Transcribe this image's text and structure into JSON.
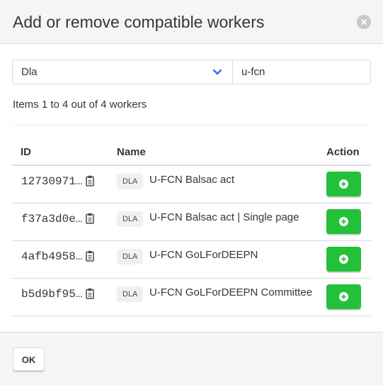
{
  "modal": {
    "title": "Add or remove compatible workers",
    "ok_label": "OK"
  },
  "filters": {
    "type_value": "Dla",
    "search_value": "u-fcn"
  },
  "pagination_text": "Items 1 to 4 out of 4 workers",
  "table": {
    "columns": {
      "id": "ID",
      "name": "Name",
      "action": "Action"
    },
    "rows": [
      {
        "id": "12730971…",
        "type": "DLA",
        "name": "U-FCN Balsac act"
      },
      {
        "id": "f37a3d0e…",
        "type": "DLA",
        "name": "U-FCN Balsac act | Single page"
      },
      {
        "id": "4afb4958…",
        "type": "DLA",
        "name": "U-FCN GoLForDEEPN"
      },
      {
        "id": "b5d9bf95…",
        "type": "DLA",
        "name": "U-FCN GoLForDEEPN Committee"
      }
    ]
  },
  "icons": {
    "close": "close-icon",
    "select_arrow": "chevron-down-icon",
    "copy": "clipboard-icon",
    "add": "plus-circle-icon"
  },
  "colors": {
    "accent": "#3273dc",
    "add_button": "#23c13a",
    "header_bg": "#f5f5f5"
  }
}
